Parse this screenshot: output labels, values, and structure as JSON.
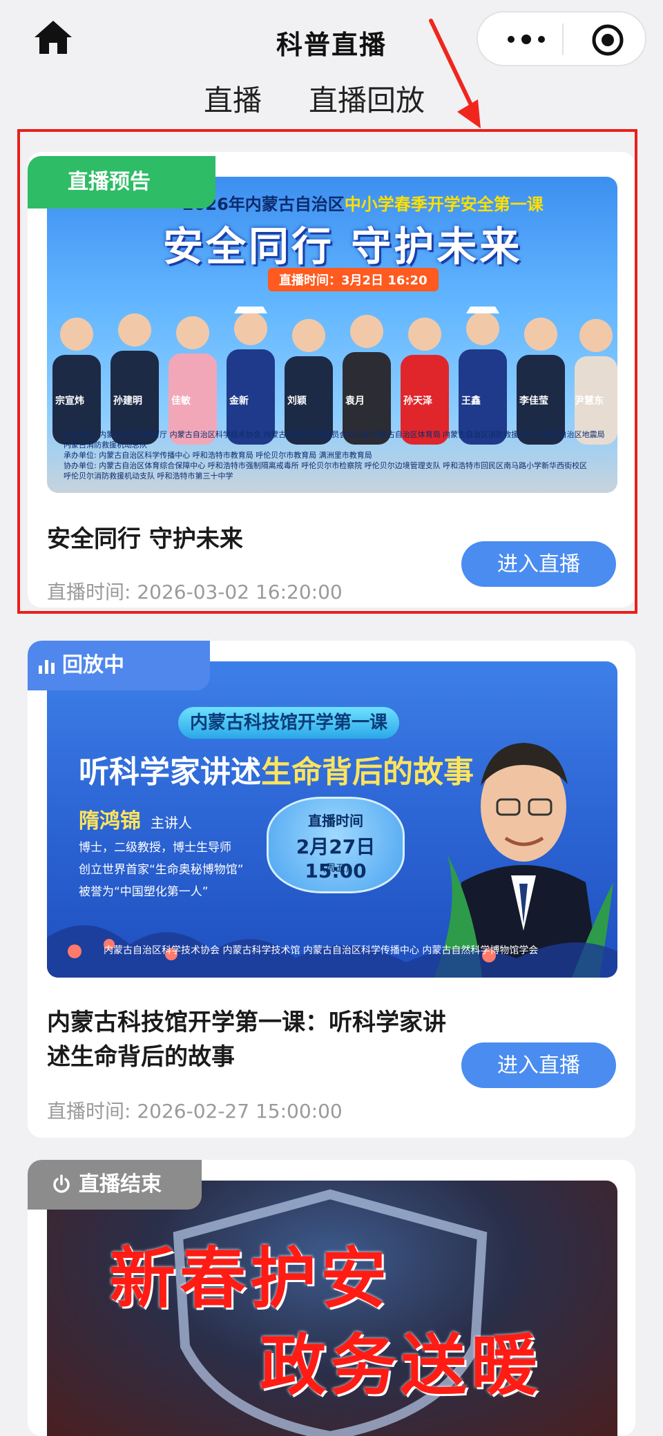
{
  "header": {
    "title": "科普直播",
    "home_icon": "home-icon",
    "more_icon": "more-dots-icon",
    "target_icon": "target-icon"
  },
  "tabs": [
    {
      "label": "直播",
      "active": true
    },
    {
      "label": "直播回放",
      "active": false
    }
  ],
  "cards": [
    {
      "badge": "直播预告",
      "badge_color": "#2ebc66",
      "title": "安全同行 守护未来",
      "time": "直播时间: 2026-03-02 16:20:00",
      "button": "进入直播",
      "banner": {
        "head_prefix": "2026年内蒙古自治区",
        "head_highlight": "中小学春季开学安全第一课",
        "main": "安全同行 守护未来",
        "time": "直播时间：3月2日 16:20",
        "names": [
          "宗宣炜",
          "孙建明",
          "佳敏",
          "金新",
          "刘颖",
          "袁月",
          "孙天泽",
          "王鑫",
          "李佳莹",
          "尹慧东"
        ],
        "orgs": [
          "主办单位: 内蒙古自治区教育厅  内蒙古自治区科学技术协会  内蒙古自治区禁毒委员会办公室  内蒙古自治区体育局  内蒙古自治区消防救援总队  内蒙古自治区地震局",
          "内蒙古消防救援机动总队",
          "承办单位: 内蒙古自治区科学传播中心  呼和浩特市教育局  呼伦贝尔市教育局  满洲里市教育局",
          "协办单位: 内蒙古自治区体育综合保障中心  呼和浩特市强制隔离戒毒所  呼伦贝尔市检察院  呼伦贝尔边境管理支队  呼和浩特市回民区南马路小学新华西街校区",
          "呼伦贝尔消防救援机动支队  呼和浩特市第三十中学"
        ]
      }
    },
    {
      "badge": "回放中",
      "badge_color": "#4f87ec",
      "badge_icon": "bar-chart-icon",
      "title": "内蒙古科技馆开学第一课：听科学家讲述生命背后的故事",
      "time": "直播时间: 2026-02-27 15:00:00",
      "button": "进入直播",
      "banner": {
        "pill": "内蒙古科技馆开学第一课",
        "main_prefix": "听科学家讲述",
        "main_highlight": "生命背后的故事",
        "speaker": "隋鸿锦",
        "speaker_role": "主讲人",
        "desc": [
          "博士，二级教授，博士生导师",
          "创立世界首家“生命奥秘博物馆”",
          "被誉为“中国塑化第一人”"
        ],
        "bubble_l1": "直播时间",
        "bubble_l2": "2月27日 15:00",
        "bubble_l3": "(周五)",
        "orgs": "内蒙古自治区科学技术协会  内蒙古科学技术馆  内蒙古自治区科学传播中心  内蒙古自然科学博物馆学会"
      }
    },
    {
      "badge": "直播结束",
      "badge_color": "#8c8c8c",
      "badge_icon": "power-icon",
      "banner": {
        "line1": "新春护安",
        "line2": "政务送暖"
      }
    }
  ],
  "highlight_color": "#e8201b",
  "accent": "#4a8cf0"
}
